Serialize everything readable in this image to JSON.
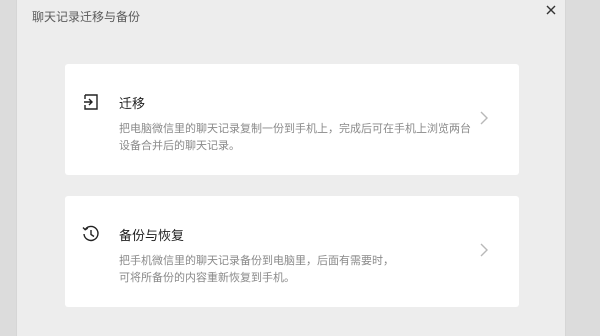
{
  "dialog": {
    "title": "聊天记录迁移与备份",
    "close_icon": "close-icon"
  },
  "cards": [
    {
      "icon": "migrate-icon",
      "title": "迁移",
      "description": "把电脑微信里的聊天记录复制一份到手机上，完成后可在手机上浏览两台设备合并后的聊天记录。"
    },
    {
      "icon": "history-restore-icon",
      "title": "备份与恢复",
      "description_lines": [
        "把手机微信里的聊天记录备份到电脑里，后面有需要时，",
        "可将所备份的内容重新恢复到手机。"
      ]
    }
  ],
  "colors": {
    "dialog_bg": "#ededed",
    "card_bg": "#ffffff",
    "title_text": "#1f1f1f",
    "desc_text": "#8a8a8a"
  }
}
